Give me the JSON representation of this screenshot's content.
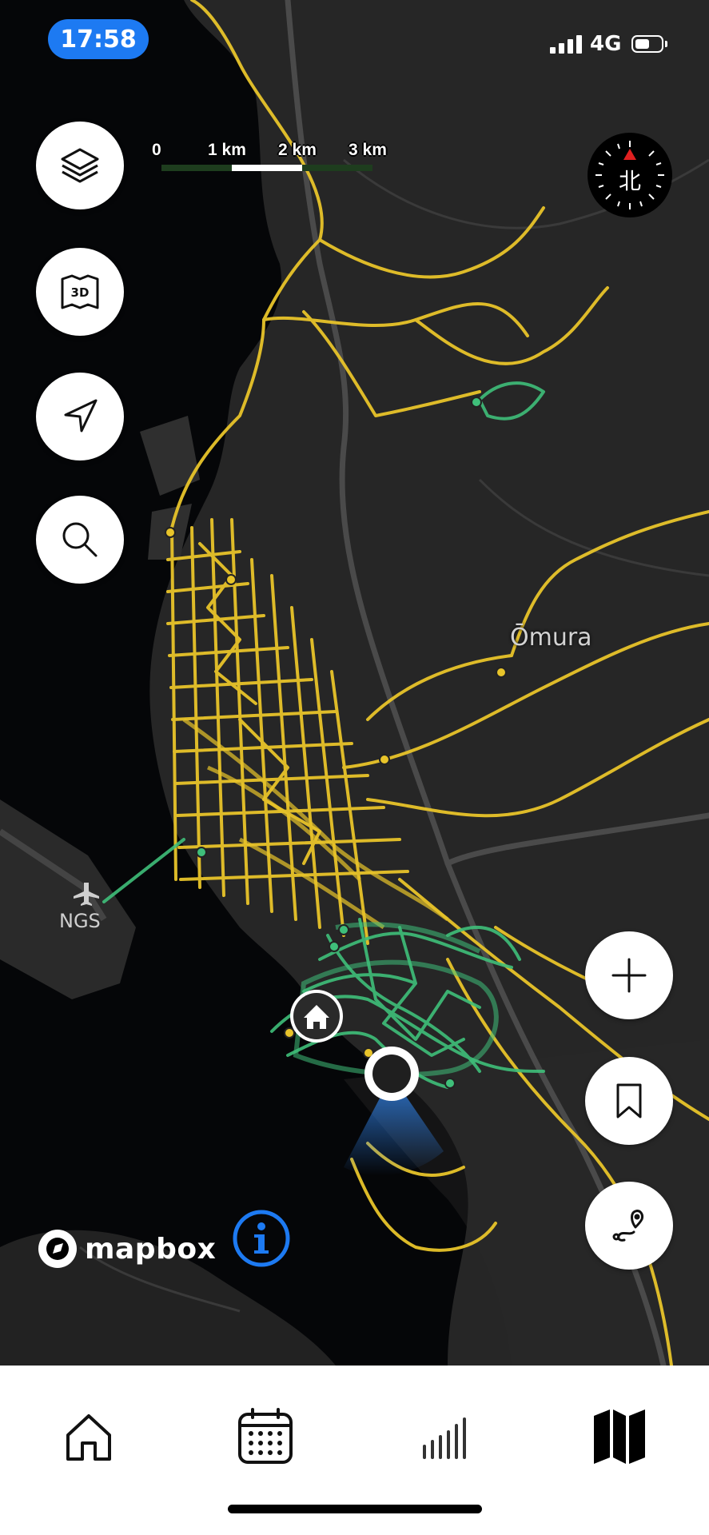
{
  "status_bar": {
    "time": "17:58",
    "network": "4G",
    "signal_bars": 4,
    "battery_level": 0.55
  },
  "map": {
    "scale_labels": [
      "0",
      "1 km",
      "2 km",
      "3 km"
    ],
    "compass_label": "北",
    "place_label": "Ōmura",
    "airport_code": "NGS",
    "attribution": "mapbox",
    "colors": {
      "background": "#262626",
      "sea": "#050608",
      "route_yellow": "#e8c42a",
      "route_green": "#3fbf7a",
      "location": "#1f1f1f",
      "accuracy_cone": "#2f7ee0"
    }
  },
  "map_controls": {
    "left": [
      "layers-icon",
      "map-3d-icon",
      "location-arrow-icon",
      "search-icon"
    ],
    "right": [
      "plus-icon",
      "bookmark-icon",
      "route-pin-icon"
    ]
  },
  "tab_bar": {
    "tabs": [
      "home-icon",
      "calendar-icon",
      "stats-icon",
      "map-icon"
    ],
    "active": "map-icon"
  }
}
